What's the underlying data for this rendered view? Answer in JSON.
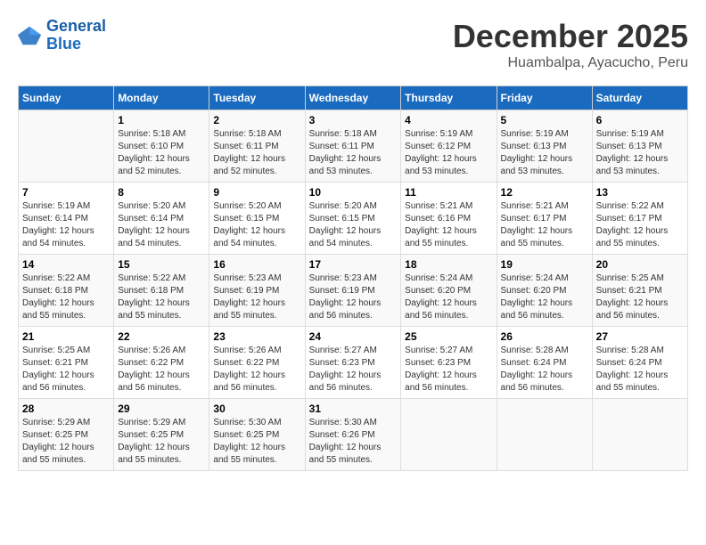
{
  "logo": {
    "line1": "General",
    "line2": "Blue"
  },
  "title": "December 2025",
  "location": "Huambalpa, Ayacucho, Peru",
  "days_of_week": [
    "Sunday",
    "Monday",
    "Tuesday",
    "Wednesday",
    "Thursday",
    "Friday",
    "Saturday"
  ],
  "weeks": [
    [
      {
        "num": "",
        "info": ""
      },
      {
        "num": "1",
        "info": "Sunrise: 5:18 AM\nSunset: 6:10 PM\nDaylight: 12 hours\nand 52 minutes."
      },
      {
        "num": "2",
        "info": "Sunrise: 5:18 AM\nSunset: 6:11 PM\nDaylight: 12 hours\nand 52 minutes."
      },
      {
        "num": "3",
        "info": "Sunrise: 5:18 AM\nSunset: 6:11 PM\nDaylight: 12 hours\nand 53 minutes."
      },
      {
        "num": "4",
        "info": "Sunrise: 5:19 AM\nSunset: 6:12 PM\nDaylight: 12 hours\nand 53 minutes."
      },
      {
        "num": "5",
        "info": "Sunrise: 5:19 AM\nSunset: 6:13 PM\nDaylight: 12 hours\nand 53 minutes."
      },
      {
        "num": "6",
        "info": "Sunrise: 5:19 AM\nSunset: 6:13 PM\nDaylight: 12 hours\nand 53 minutes."
      }
    ],
    [
      {
        "num": "7",
        "info": "Sunrise: 5:19 AM\nSunset: 6:14 PM\nDaylight: 12 hours\nand 54 minutes."
      },
      {
        "num": "8",
        "info": "Sunrise: 5:20 AM\nSunset: 6:14 PM\nDaylight: 12 hours\nand 54 minutes."
      },
      {
        "num": "9",
        "info": "Sunrise: 5:20 AM\nSunset: 6:15 PM\nDaylight: 12 hours\nand 54 minutes."
      },
      {
        "num": "10",
        "info": "Sunrise: 5:20 AM\nSunset: 6:15 PM\nDaylight: 12 hours\nand 54 minutes."
      },
      {
        "num": "11",
        "info": "Sunrise: 5:21 AM\nSunset: 6:16 PM\nDaylight: 12 hours\nand 55 minutes."
      },
      {
        "num": "12",
        "info": "Sunrise: 5:21 AM\nSunset: 6:17 PM\nDaylight: 12 hours\nand 55 minutes."
      },
      {
        "num": "13",
        "info": "Sunrise: 5:22 AM\nSunset: 6:17 PM\nDaylight: 12 hours\nand 55 minutes."
      }
    ],
    [
      {
        "num": "14",
        "info": "Sunrise: 5:22 AM\nSunset: 6:18 PM\nDaylight: 12 hours\nand 55 minutes."
      },
      {
        "num": "15",
        "info": "Sunrise: 5:22 AM\nSunset: 6:18 PM\nDaylight: 12 hours\nand 55 minutes."
      },
      {
        "num": "16",
        "info": "Sunrise: 5:23 AM\nSunset: 6:19 PM\nDaylight: 12 hours\nand 55 minutes."
      },
      {
        "num": "17",
        "info": "Sunrise: 5:23 AM\nSunset: 6:19 PM\nDaylight: 12 hours\nand 56 minutes."
      },
      {
        "num": "18",
        "info": "Sunrise: 5:24 AM\nSunset: 6:20 PM\nDaylight: 12 hours\nand 56 minutes."
      },
      {
        "num": "19",
        "info": "Sunrise: 5:24 AM\nSunset: 6:20 PM\nDaylight: 12 hours\nand 56 minutes."
      },
      {
        "num": "20",
        "info": "Sunrise: 5:25 AM\nSunset: 6:21 PM\nDaylight: 12 hours\nand 56 minutes."
      }
    ],
    [
      {
        "num": "21",
        "info": "Sunrise: 5:25 AM\nSunset: 6:21 PM\nDaylight: 12 hours\nand 56 minutes."
      },
      {
        "num": "22",
        "info": "Sunrise: 5:26 AM\nSunset: 6:22 PM\nDaylight: 12 hours\nand 56 minutes."
      },
      {
        "num": "23",
        "info": "Sunrise: 5:26 AM\nSunset: 6:22 PM\nDaylight: 12 hours\nand 56 minutes."
      },
      {
        "num": "24",
        "info": "Sunrise: 5:27 AM\nSunset: 6:23 PM\nDaylight: 12 hours\nand 56 minutes."
      },
      {
        "num": "25",
        "info": "Sunrise: 5:27 AM\nSunset: 6:23 PM\nDaylight: 12 hours\nand 56 minutes."
      },
      {
        "num": "26",
        "info": "Sunrise: 5:28 AM\nSunset: 6:24 PM\nDaylight: 12 hours\nand 56 minutes."
      },
      {
        "num": "27",
        "info": "Sunrise: 5:28 AM\nSunset: 6:24 PM\nDaylight: 12 hours\nand 55 minutes."
      }
    ],
    [
      {
        "num": "28",
        "info": "Sunrise: 5:29 AM\nSunset: 6:25 PM\nDaylight: 12 hours\nand 55 minutes."
      },
      {
        "num": "29",
        "info": "Sunrise: 5:29 AM\nSunset: 6:25 PM\nDaylight: 12 hours\nand 55 minutes."
      },
      {
        "num": "30",
        "info": "Sunrise: 5:30 AM\nSunset: 6:25 PM\nDaylight: 12 hours\nand 55 minutes."
      },
      {
        "num": "31",
        "info": "Sunrise: 5:30 AM\nSunset: 6:26 PM\nDaylight: 12 hours\nand 55 minutes."
      },
      {
        "num": "",
        "info": ""
      },
      {
        "num": "",
        "info": ""
      },
      {
        "num": "",
        "info": ""
      }
    ]
  ]
}
